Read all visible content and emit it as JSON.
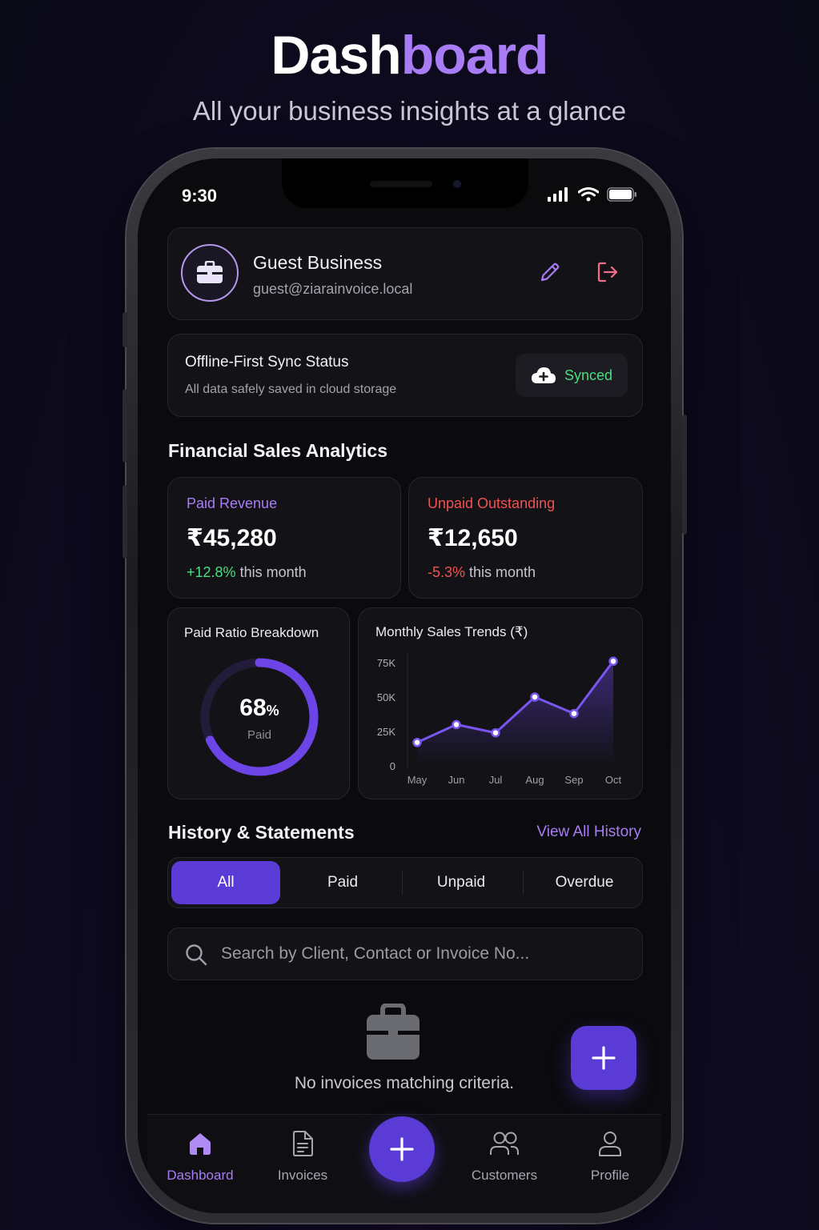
{
  "hero": {
    "title_part1": "Dash",
    "title_part2": "board",
    "subtitle": "All your business insights at a glance"
  },
  "status_bar": {
    "time": "9:30"
  },
  "profile": {
    "business_name": "Guest Business",
    "email": "guest@ziarainvoice.local"
  },
  "sync": {
    "title": "Offline-First Sync Status",
    "subtitle": "All data safely saved in cloud storage",
    "status": "Synced"
  },
  "analytics": {
    "section_title": "Financial Sales Analytics",
    "paid": {
      "label": "Paid Revenue",
      "value": "₹45,280",
      "change": "+12.8%",
      "period": " this month"
    },
    "unpaid": {
      "label": "Unpaid Outstanding",
      "value": "₹12,650",
      "change": "-5.3%",
      "period": " this month"
    },
    "ratio": {
      "title": "Paid Ratio Breakdown",
      "value": "68",
      "unit": "%",
      "caption": "Paid",
      "fraction": 0.68
    }
  },
  "chart_data": {
    "type": "area",
    "title": "Monthly Sales Trends (₹)",
    "categories": [
      "May",
      "Jun",
      "Jul",
      "Aug",
      "Sep",
      "Oct"
    ],
    "values": [
      17000,
      30000,
      24000,
      50000,
      38000,
      76000
    ],
    "y_ticks": [
      "0",
      "25K",
      "50K",
      "75K"
    ],
    "y_tick_values": [
      0,
      25000,
      50000,
      75000
    ],
    "ylim": [
      0,
      75000
    ],
    "grid": false
  },
  "history": {
    "section_title": "History & Statements",
    "view_all": "View All History",
    "tabs": [
      "All",
      "Paid",
      "Unpaid",
      "Overdue"
    ],
    "active_tab": "All",
    "search_placeholder": "Search by Client, Contact or Invoice No...",
    "empty_message": "No invoices matching criteria."
  },
  "bottom_nav": [
    {
      "label": "Dashboard",
      "icon": "home-icon",
      "active": true
    },
    {
      "label": "Invoices",
      "icon": "document-icon",
      "active": false
    },
    {
      "label": "Customers",
      "icon": "users-icon",
      "active": false
    },
    {
      "label": "Profile",
      "icon": "user-icon",
      "active": false
    }
  ],
  "colors": {
    "accent": "#5b3bd6",
    "accent_light": "#a87cf4",
    "success": "#4ade80",
    "danger": "#f05252",
    "logout": "#f06e8a"
  }
}
